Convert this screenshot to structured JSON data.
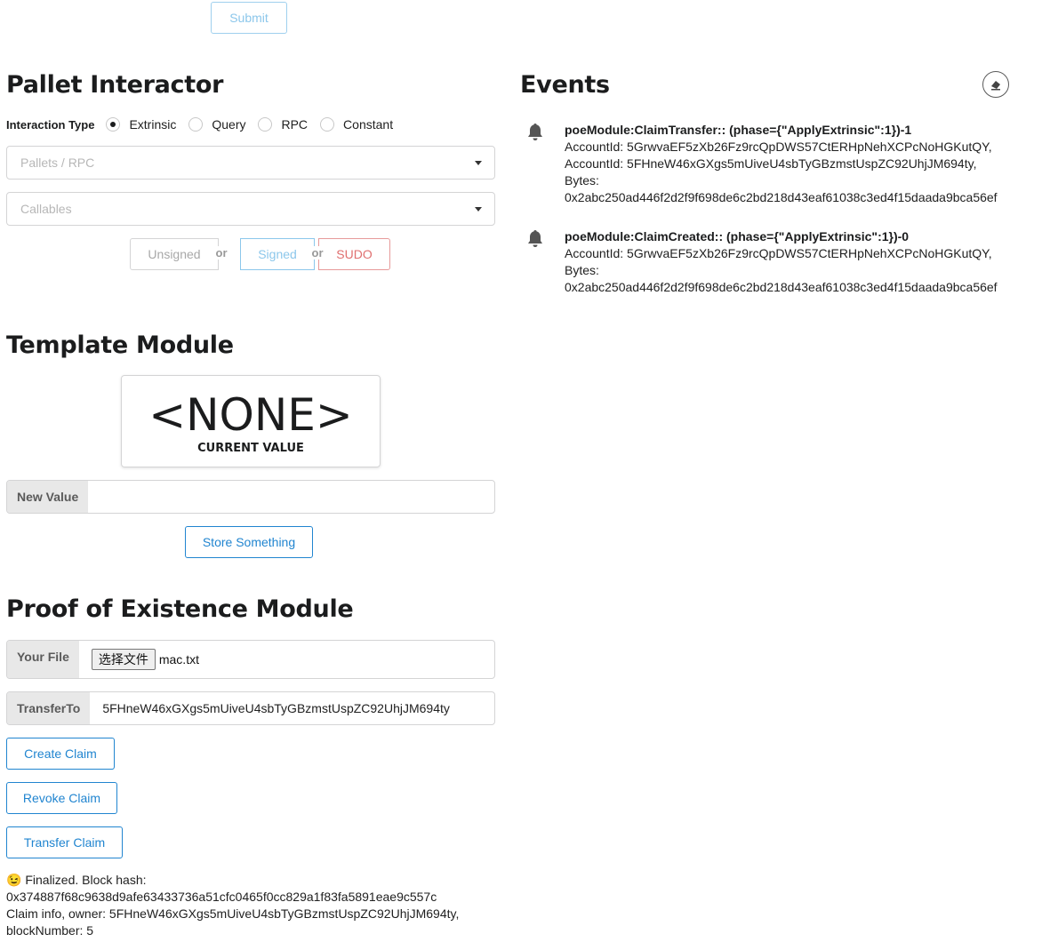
{
  "top": {
    "submit_label": "Submit"
  },
  "pallet": {
    "title": "Pallet Interactor",
    "interaction_type_label": "Interaction Type",
    "options": [
      "Extrinsic",
      "Query",
      "RPC",
      "Constant"
    ],
    "selected": "Extrinsic",
    "pallets_placeholder": "Pallets / RPC",
    "callables_placeholder": "Callables",
    "unsigned_label": "Unsigned",
    "or1": "or",
    "signed_label": "Signed",
    "or2": "or",
    "sudo_label": "SUDO"
  },
  "events": {
    "title": "Events",
    "items": [
      {
        "head": "poeModule:ClaimTransfer:: (phase={\"ApplyExtrinsic\":1})-1",
        "lines": [
          "AccountId: 5GrwvaEF5zXb26Fz9rcQpDWS57CtERHpNehXCPcNoHGKutQY,",
          "AccountId: 5FHneW46xGXgs5mUiveU4sbTyGBzmstUspZC92UhjJM694ty,",
          "Bytes:",
          "0x2abc250ad446f2d2f9f698de6c2bd218d43eaf61038c3ed4f15daada9bca56ef"
        ]
      },
      {
        "head": "poeModule:ClaimCreated:: (phase={\"ApplyExtrinsic\":1})-0",
        "lines": [
          "AccountId: 5GrwvaEF5zXb26Fz9rcQpDWS57CtERHpNehXCPcNoHGKutQY,",
          "Bytes:",
          "0x2abc250ad446f2d2f9f698de6c2bd218d43eaf61038c3ed4f15daada9bca56ef"
        ]
      }
    ]
  },
  "template": {
    "title": "Template Module",
    "value": "<NONE>",
    "value_caption": "CURRENT VALUE",
    "new_value_label": "New Value",
    "new_value": "",
    "store_label": "Store Something"
  },
  "poe": {
    "title": "Proof of Existence Module",
    "file_label": "Your File",
    "file_button": "选择文件",
    "file_name": "mac.txt",
    "transfer_label": "TransferTo",
    "transfer_value": "5FHneW46xGXgs5mUiveU4sbTyGBzmstUspZC92UhjJM694ty",
    "create_label": "Create Claim",
    "revoke_label": "Revoke Claim",
    "transfer_btn_label": "Transfer Claim",
    "status_emoji": "😉",
    "status_lines": [
      "Finalized. Block hash:",
      "0x374887f68c9638d9afe63433736a51cfc0465f0cc829a1f83fa5891eae9c557c",
      "Claim info, owner: 5FHneW46xGXgs5mUiveU4sbTyGBzmstUspZC92UhjJM694ty,",
      "blockNumber: 5"
    ]
  },
  "colors": {
    "accent": "#2185d0",
    "sudo": "#db2828",
    "disabled_blue": "#8cc7eb"
  }
}
